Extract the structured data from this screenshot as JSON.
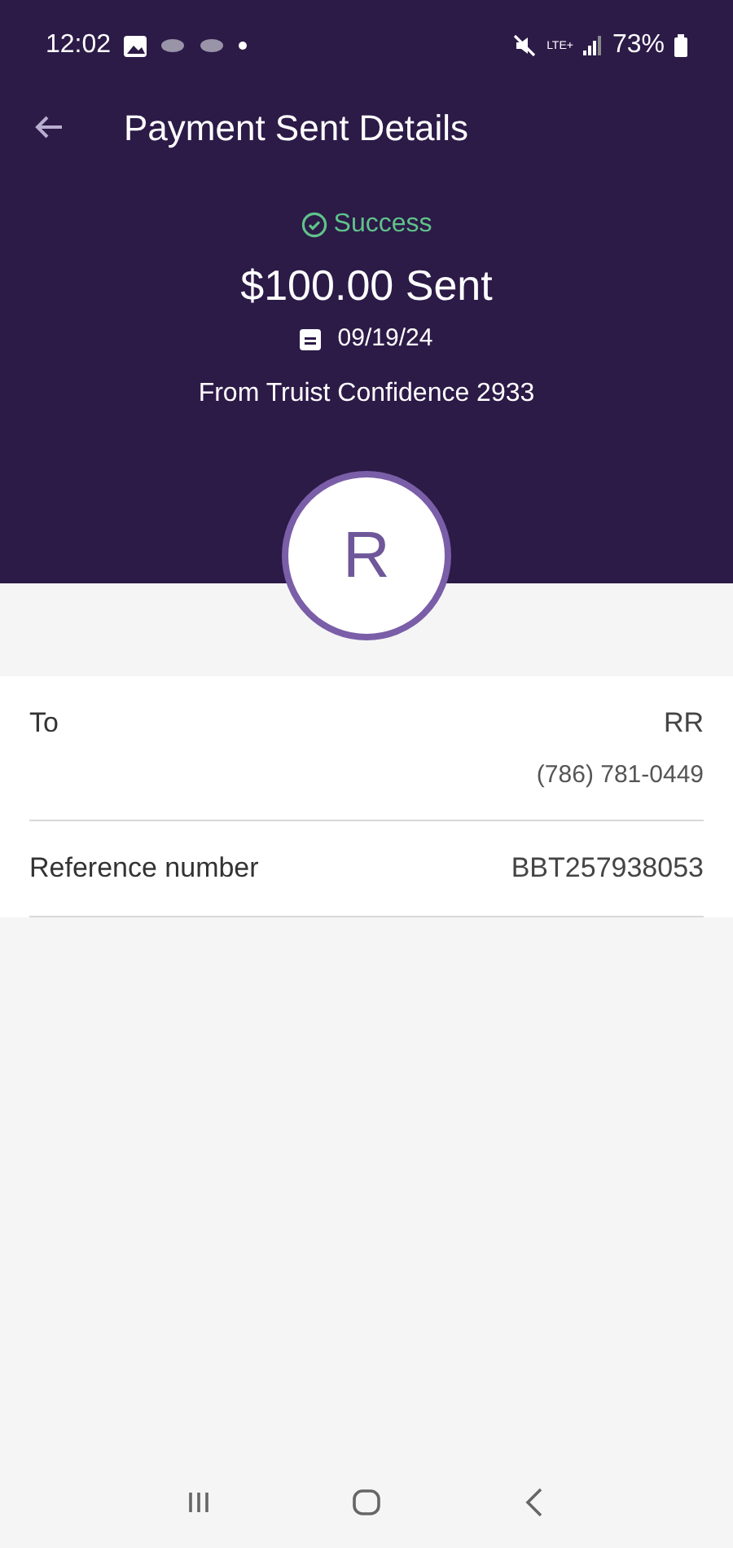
{
  "status_bar": {
    "time": "12:02",
    "network": "LTE+",
    "battery": "73%"
  },
  "header": {
    "title": "Payment Sent Details"
  },
  "summary": {
    "status": "Success",
    "amount": "$100.00 Sent",
    "date": "09/19/24",
    "from": "From Truist Confidence 2933",
    "avatar_initial": "R"
  },
  "details": [
    {
      "label": "To",
      "values": [
        "RR",
        "(786) 781-0449"
      ]
    },
    {
      "label": "Reference number",
      "values": [
        "BBT257938053"
      ]
    }
  ]
}
